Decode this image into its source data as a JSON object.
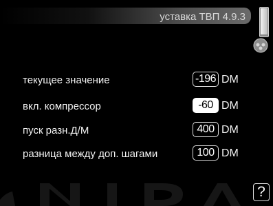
{
  "header": {
    "title": "уставка ТВП 4.9.3"
  },
  "rows": [
    {
      "label": "текущее значение",
      "value": "-196",
      "unit": "DM"
    },
    {
      "label": "вкл. компрессор",
      "value": "-60",
      "unit": "DM",
      "selected": true
    },
    {
      "label": "пуск разн.Д/М",
      "value": "400",
      "unit": "DM"
    },
    {
      "label": "разница между доп. шагами",
      "value": "100",
      "unit": "DM"
    }
  ],
  "help": {
    "label": "?"
  },
  "icons": {
    "scrollbar": "scrollbar",
    "thumb": "thumb-control-icon",
    "help": "help-icon"
  },
  "colors": {
    "background": "#000000",
    "text": "#ffffff",
    "selected_background": "#ffffff",
    "selected_text": "#000000"
  }
}
